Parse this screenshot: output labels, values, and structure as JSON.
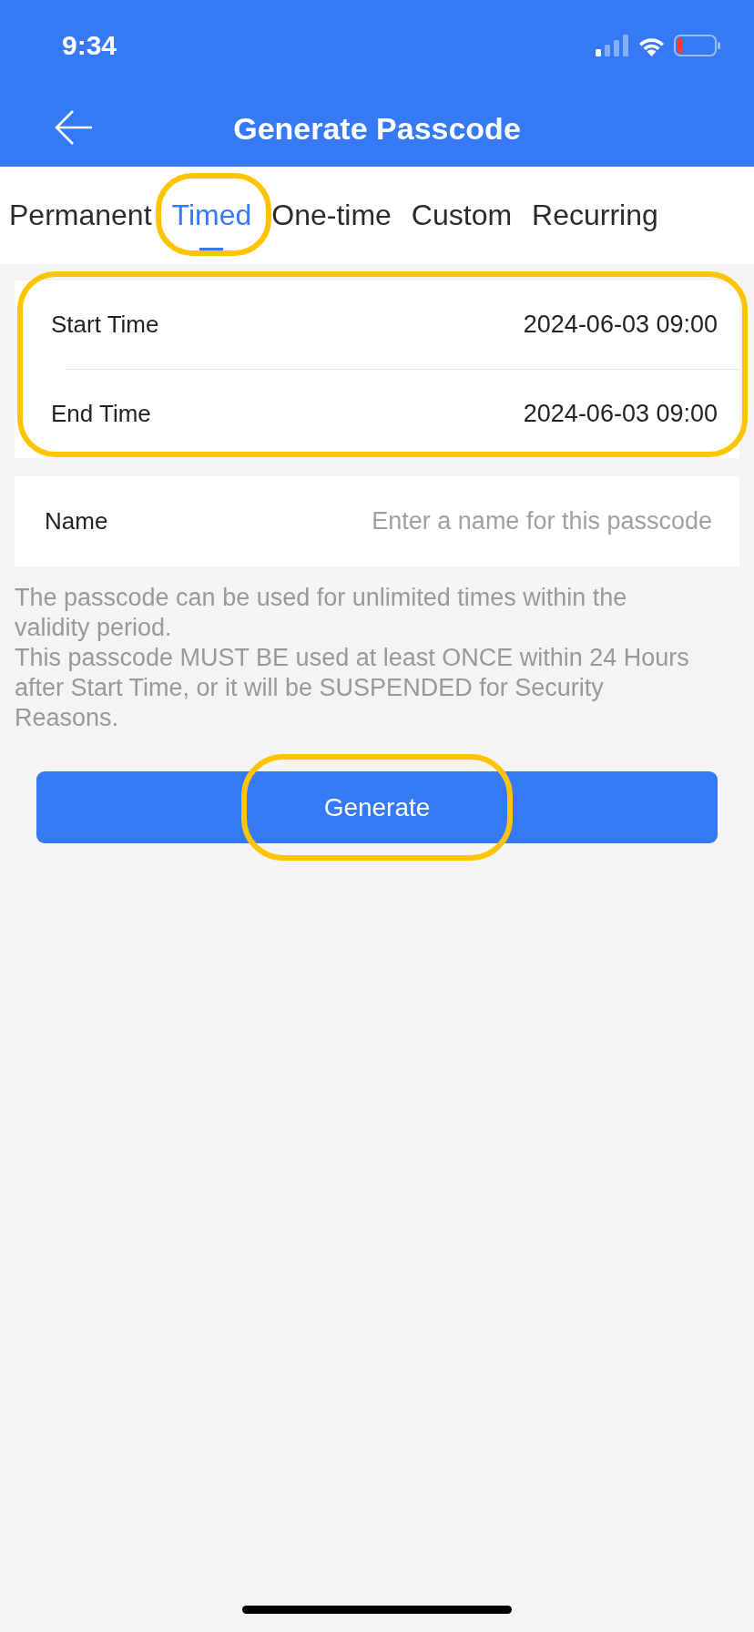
{
  "status_bar": {
    "time": "9:34"
  },
  "header": {
    "title": "Generate Passcode"
  },
  "tabs": [
    {
      "label": "Permanent",
      "selected": false,
      "highlighted": false
    },
    {
      "label": "Timed",
      "selected": true,
      "highlighted": true
    },
    {
      "label": "One-time",
      "selected": false,
      "highlighted": false
    },
    {
      "label": "Custom",
      "selected": false,
      "highlighted": false
    },
    {
      "label": "Recurring",
      "selected": false,
      "highlighted": false
    }
  ],
  "time_card": {
    "highlighted": true,
    "rows": [
      {
        "label": "Start Time",
        "value": "2024-06-03 09:00"
      },
      {
        "label": "End Time",
        "value": "2024-06-03 09:00"
      }
    ]
  },
  "name_field": {
    "label": "Name",
    "placeholder": "Enter a name for this passcode"
  },
  "notes": [
    "The passcode can be used for unlimited times within the validity period.",
    "This passcode MUST BE used at least ONCE within 24 Hours after Start Time, or it will be SUSPENDED for Security Reasons."
  ],
  "generate_button": {
    "label": "Generate",
    "highlighted": true
  }
}
